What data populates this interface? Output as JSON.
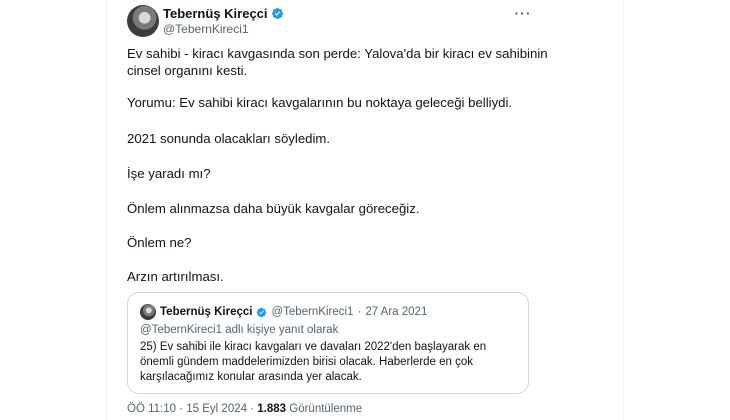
{
  "author": {
    "display_name": "Tebernüş Kireçci",
    "handle": "@TebernKireci1"
  },
  "tweet": {
    "paragraphs": [
      "Ev sahibi - kiracı kavgasında son perde: Yalova'da bir kiracı ev sahibinin\ncinsel organını kesti.",
      "Yorumu: Ev sahibi kiracı kavgalarının bu noktaya geleceği belliydi.",
      "2021 sonunda olacakları söyledim.",
      "İşe yaradı mı?",
      "Önlem alınmazsa daha büyük kavgalar göreceğiz.",
      "Önlem ne?",
      "Arzın artırılması."
    ]
  },
  "quoted_tweet": {
    "display_name": "Tebernüş Kireçci",
    "handle": "@TebernKireci1",
    "separator": "·",
    "date": "27 Ara 2021",
    "reply_to": "@TebernKireci1 adlı kişiye yanıt olarak",
    "text": "25) Ev sahibi ile kiracı kavgaları ve davaları 2022'den başlayarak en önemli gündem maddelerimizden birisi olacak. Haberlerde en çok karşılacağımız konular arasında yer alacak."
  },
  "meta": {
    "time": "ÖÖ 11:10",
    "separator": "·",
    "date": "15 Eyl 2024",
    "views_count": "1.883",
    "views_label": "Görüntülenme"
  },
  "colors": {
    "verified": "#1d9bf0",
    "secondary_text": "#536471",
    "primary_text": "#0f1419",
    "border": "#cfd9de"
  },
  "icons": {
    "verified": "verified-badge-icon",
    "more": "more-options-icon"
  }
}
